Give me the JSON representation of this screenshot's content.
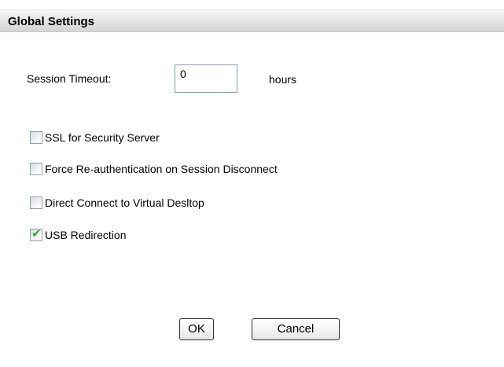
{
  "header": {
    "title": "Global Settings"
  },
  "session_timeout": {
    "label": "Session Timeout:",
    "value": "0",
    "unit": "hours"
  },
  "options": [
    {
      "label": "SSL for Security Server",
      "checked": false
    },
    {
      "label": "Force Re-authentication on Session Disconnect",
      "checked": false
    },
    {
      "label": "Direct Connect to Virtual Desltop",
      "checked": false
    },
    {
      "label": "USB Redirection",
      "checked": true
    }
  ],
  "buttons": {
    "ok_label": "OK",
    "cancel_label": "Cancel"
  },
  "colors": {
    "checkmark": "#2aa52a",
    "input_border": "#7f9db9"
  }
}
